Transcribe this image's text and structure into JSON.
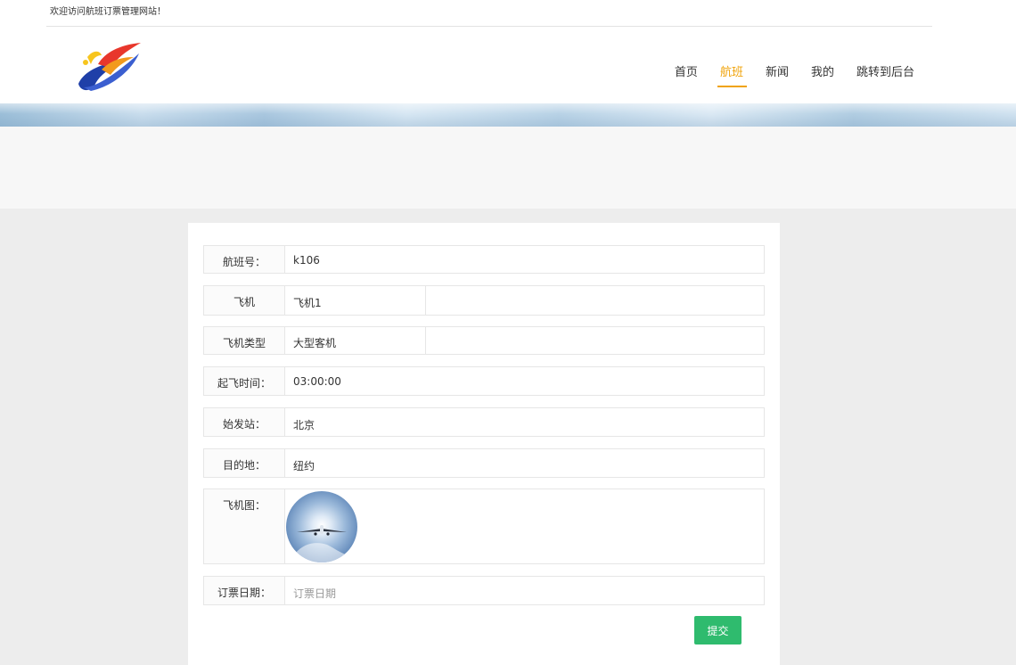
{
  "site": {
    "welcome": "欢迎访问航班订票管理网站！"
  },
  "nav": {
    "items": [
      {
        "label": "首页",
        "active": false
      },
      {
        "label": "航班",
        "active": true
      },
      {
        "label": "新闻",
        "active": false
      },
      {
        "label": "我的",
        "active": false
      },
      {
        "label": "跳转到后台",
        "active": false
      }
    ],
    "active_color": "#f0a30a"
  },
  "form": {
    "flight_no": {
      "label": "航班号：",
      "value": "k106"
    },
    "plane": {
      "label": "飞机",
      "value": "飞机1"
    },
    "plane_type": {
      "label": "飞机类型",
      "value": "大型客机"
    },
    "takeoff_time": {
      "label": "起飞时间：",
      "value": "03:00:00"
    },
    "origin": {
      "label": "始发站：",
      "value": "北京"
    },
    "destination": {
      "label": "目的地：",
      "value": "纽约"
    },
    "plane_image": {
      "label": "飞机图："
    },
    "booking_date": {
      "label": "订票日期：",
      "placeholder": "订票日期"
    },
    "submit_label": "提交",
    "submit_color": "#2fbb6e"
  }
}
